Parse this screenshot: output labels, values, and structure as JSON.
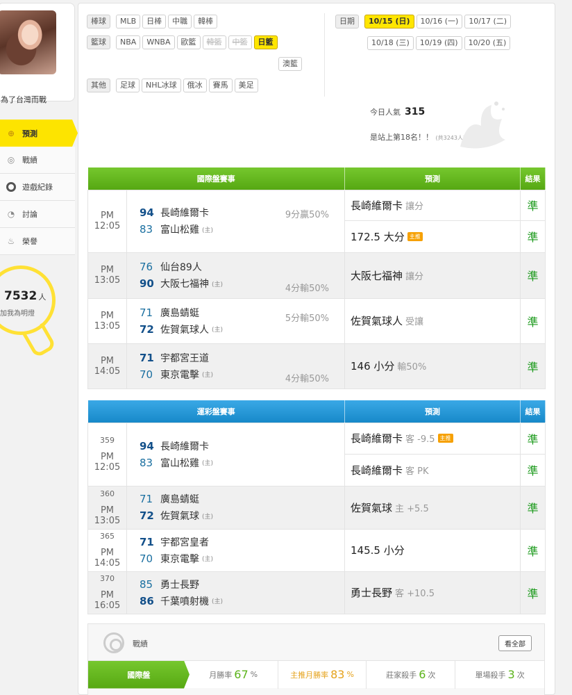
{
  "profile": {
    "name": "為了台灣而戰"
  },
  "sidebar": {
    "items": [
      {
        "label": "預測",
        "icon": "target-icon",
        "active": true
      },
      {
        "label": "戰績",
        "icon": "record-icon"
      },
      {
        "label": "遊戲紀錄",
        "icon": "ring-icon"
      },
      {
        "label": "討論",
        "icon": "discussion-icon"
      },
      {
        "label": "榮譽",
        "icon": "medal-icon"
      }
    ]
  },
  "fans": {
    "count": "7532",
    "unit": "人",
    "cta": "加我為明燈"
  },
  "filters": {
    "baseball": {
      "label": "棒球",
      "items": [
        "MLB",
        "日棒",
        "中職",
        "韓棒"
      ]
    },
    "basketball": {
      "label": "籃球",
      "items": [
        "NBA",
        "WNBA",
        "歐籃",
        "韓籃",
        "中籃",
        "日籃",
        "澳籃"
      ],
      "disabled": [
        "韓籃",
        "中籃"
      ],
      "selected": "日籃"
    },
    "other": {
      "label": "其他",
      "items": [
        "足球",
        "NHL冰球",
        "俄冰",
        "賽馬",
        "美足"
      ]
    },
    "date": {
      "label": "日期",
      "items": [
        "10/15 (日)",
        "10/16 (一)",
        "10/17 (二)",
        "10/18 (三)",
        "10/19 (四)",
        "10/20 (五)"
      ],
      "selected": "10/15 (日)"
    }
  },
  "popularity": {
    "label": "今日人氣",
    "value": "315",
    "rank_text": "是站上第18名！！",
    "rank_total": "(共3243人)"
  },
  "intl": {
    "headers": {
      "match": "國際盤賽事",
      "pred": "預測",
      "result": "結果"
    },
    "games": [
      {
        "time": "PM 12:05",
        "home_tag": "(主)",
        "teams": [
          {
            "score": "94",
            "name": "長崎維爾卡",
            "win": true
          },
          {
            "score": "83",
            "name": "富山松雞",
            "home": true
          }
        ],
        "spread": "9分贏50%",
        "spread_row": 0,
        "preds": [
          {
            "main": "長崎維爾卡",
            "sub": "讓分",
            "result": "準"
          },
          {
            "main": "172.5 大分",
            "badge": "主推",
            "result": "準"
          }
        ]
      },
      {
        "time": "PM 13:05",
        "teams": [
          {
            "score": "76",
            "name": "仙台89人"
          },
          {
            "score": "90",
            "name": "大阪七福神",
            "win": true,
            "home": true
          }
        ],
        "spread": "4分輸50%",
        "spread_row": 1,
        "preds": [
          {
            "main": "大阪七福神",
            "sub": "讓分",
            "result": "準"
          }
        ]
      },
      {
        "time": "PM 13:05",
        "teams": [
          {
            "score": "71",
            "name": "廣島蜻蜓"
          },
          {
            "score": "72",
            "name": "佐賀氣球人",
            "win": true,
            "home": true
          }
        ],
        "spread": "5分輸50%",
        "spread_row": 0,
        "preds": [
          {
            "main": "佐賀氣球人",
            "sub": "受讓",
            "result": "準"
          }
        ]
      },
      {
        "time": "PM 14:05",
        "teams": [
          {
            "score": "71",
            "name": "宇都宮王道",
            "win": true
          },
          {
            "score": "70",
            "name": "東京電擊",
            "home": true
          }
        ],
        "spread": "4分輸50%",
        "spread_row": 1,
        "preds": [
          {
            "main": "146 小分",
            "sub": "輸50%",
            "result": "準"
          }
        ]
      }
    ]
  },
  "lottery": {
    "headers": {
      "match": "運彩盤賽事",
      "pred": "預測",
      "result": "結果"
    },
    "games": [
      {
        "id": "359",
        "time": "PM 12:05",
        "teams": [
          {
            "score": "94",
            "name": "長崎維爾卡",
            "win": true
          },
          {
            "score": "83",
            "name": "富山松雞",
            "home": true
          }
        ],
        "preds": [
          {
            "main": "長崎維爾卡",
            "sub": "客 -9.5",
            "badge": "主推",
            "result": "準"
          },
          {
            "main": "長崎維爾卡",
            "sub": "客 PK",
            "result": "準"
          }
        ]
      },
      {
        "id": "360",
        "time": "PM 13:05",
        "teams": [
          {
            "score": "71",
            "name": "廣島蜻蜓"
          },
          {
            "score": "72",
            "name": "佐賀氣球",
            "win": true,
            "home": true
          }
        ],
        "preds": [
          {
            "main": "佐賀氣球",
            "sub": "主 +5.5",
            "result": "準"
          }
        ]
      },
      {
        "id": "365",
        "time": "PM 14:05",
        "teams": [
          {
            "score": "71",
            "name": "宇都宮皇者",
            "win": true
          },
          {
            "score": "70",
            "name": "東京電擊",
            "home": true
          }
        ],
        "preds": [
          {
            "main": "145.5 小分",
            "sub": "",
            "result": "準"
          }
        ]
      },
      {
        "id": "370",
        "time": "PM 16:05",
        "teams": [
          {
            "score": "85",
            "name": "勇士長野"
          },
          {
            "score": "86",
            "name": "千葉噴射機",
            "win": true,
            "home": true
          }
        ],
        "preds": [
          {
            "main": "勇士長野",
            "sub": "客 +10.5",
            "result": "準"
          }
        ]
      }
    ]
  },
  "home_label": "(主)",
  "record": {
    "title": "戰績",
    "see_all": "看全部",
    "row": {
      "category": "國際盤",
      "cells": [
        {
          "label": "月勝率",
          "value": "67",
          "unit": "%",
          "style": "green"
        },
        {
          "label": "主推月勝率",
          "value": "83",
          "unit": "%",
          "style": "gold"
        },
        {
          "label": "莊家殺手",
          "value": "6",
          "unit": "次",
          "style": "plain"
        },
        {
          "label": "單場殺手",
          "value": "3",
          "unit": "次",
          "style": "plain"
        }
      ]
    }
  },
  "colors": {
    "green": "#5bb31a",
    "blue": "#1789c9",
    "yellow": "#fde400",
    "result_green": "#1c9a1c"
  }
}
